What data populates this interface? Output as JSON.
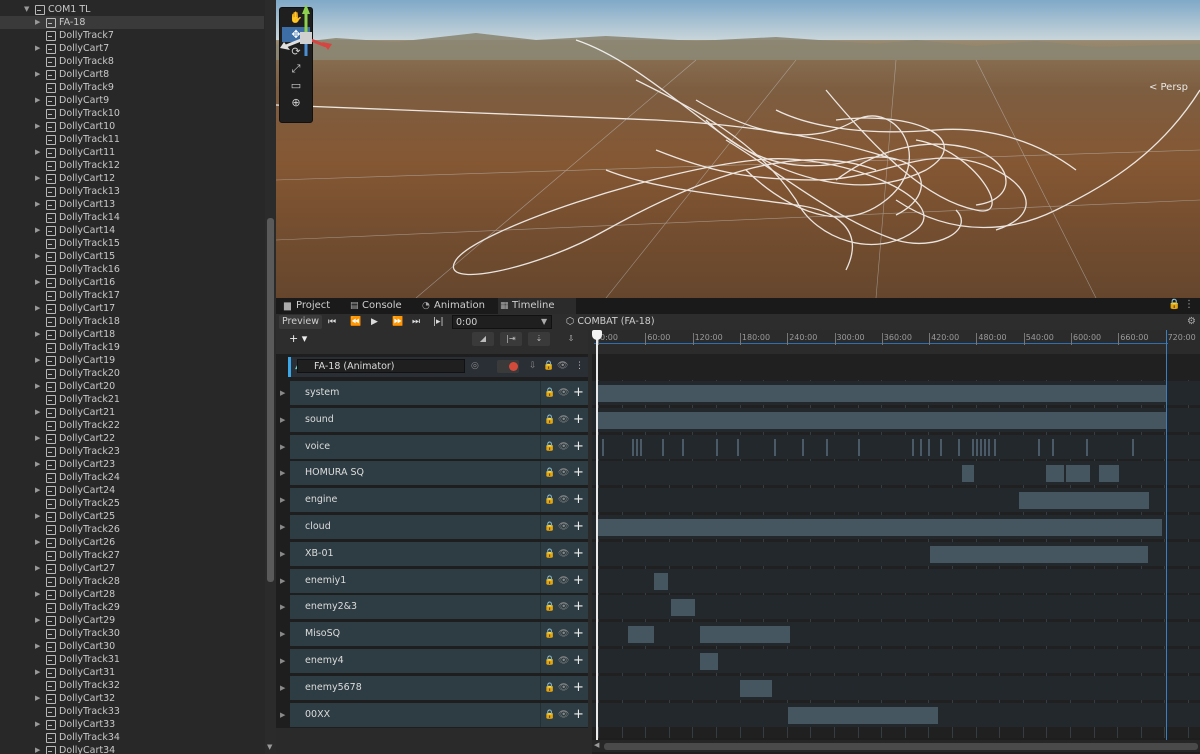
{
  "hierarchy": {
    "root_label": "COM1 TL",
    "selected_item": "FA-18",
    "items": [
      "FA-18",
      "DollyTrack7",
      "DollyCart7",
      "DollyTrack8",
      "DollyCart8",
      "DollyTrack9",
      "DollyCart9",
      "DollyTrack10",
      "DollyCart10",
      "DollyTrack11",
      "DollyCart11",
      "DollyTrack12",
      "DollyCart12",
      "DollyTrack13",
      "DollyCart13",
      "DollyTrack14",
      "DollyCart14",
      "DollyTrack15",
      "DollyCart15",
      "DollyTrack16",
      "DollyCart16",
      "DollyTrack17",
      "DollyCart17",
      "DollyTrack18",
      "DollyCart18",
      "DollyTrack19",
      "DollyCart19",
      "DollyTrack20",
      "DollyCart20",
      "DollyTrack21",
      "DollyCart21",
      "DollyTrack22",
      "DollyCart22",
      "DollyTrack23",
      "DollyCart23",
      "DollyTrack24",
      "DollyCart24",
      "DollyTrack25",
      "DollyCart25",
      "DollyTrack26",
      "DollyCart26",
      "DollyTrack27",
      "DollyCart27",
      "DollyTrack28",
      "DollyCart28",
      "DollyTrack29",
      "DollyCart29",
      "DollyTrack30",
      "DollyCart30",
      "DollyTrack31",
      "DollyCart31",
      "DollyTrack32",
      "DollyCart32",
      "DollyTrack33",
      "DollyCart33",
      "DollyTrack34",
      "DollyCart34"
    ]
  },
  "scene": {
    "camera_mode": "< Persp",
    "tools": [
      "hand-icon",
      "move-icon",
      "rotate-icon",
      "scale-icon",
      "rect-icon",
      "transform-icon"
    ],
    "active_tool": "move-icon"
  },
  "tabs": [
    {
      "label": "Project",
      "icon": "folder-icon"
    },
    {
      "label": "Console",
      "icon": "console-icon"
    },
    {
      "label": "Animation",
      "icon": "animation-icon"
    },
    {
      "label": "Timeline",
      "icon": "timeline-icon",
      "active": true
    }
  ],
  "timeline": {
    "preview_label": "Preview",
    "time_value": "0:00",
    "asset_name": "COMBAT (FA-18)",
    "add_label": "+ ▾",
    "animator_track": "FA-18 (Animator)",
    "ruler_ticks": [
      "0:00",
      "60:00",
      "120:00",
      "180:00",
      "240:00",
      "300:00",
      "360:00",
      "420:00",
      "480:00",
      "540:00",
      "600:00",
      "660:00",
      "720:00"
    ],
    "tracks": [
      "system",
      "sound",
      "voice",
      "HOMURA SQ",
      "engine",
      "cloud",
      "XB-01",
      "enemiy1",
      "enemy2&3",
      "MisoSQ",
      "enemy4",
      "enemy5678",
      "00XX"
    ]
  }
}
